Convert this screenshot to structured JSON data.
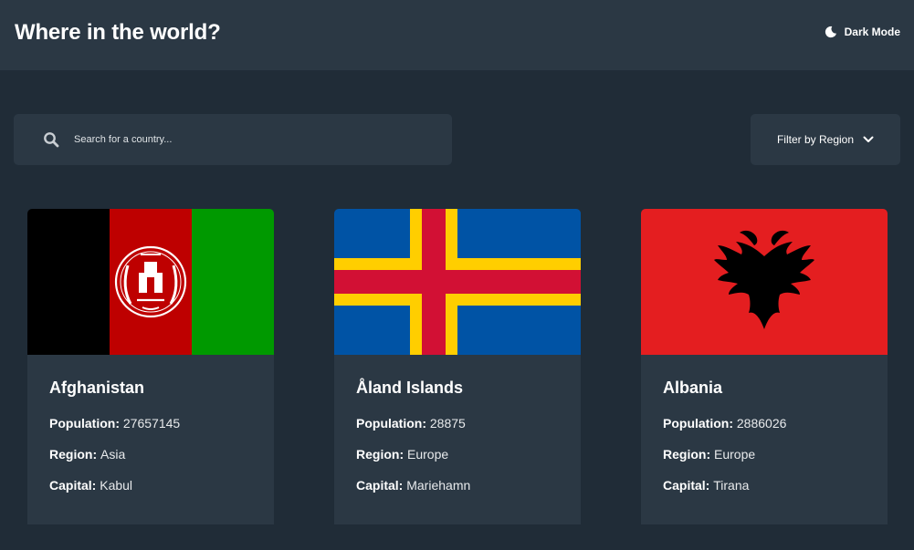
{
  "header": {
    "title": "Where in the world?",
    "mode_label": "Dark Mode"
  },
  "search": {
    "placeholder": "Search for a country..."
  },
  "filter": {
    "label": "Filter by Region"
  },
  "labels": {
    "population": "Population:",
    "region": "Region:",
    "capital": "Capital:"
  },
  "countries": [
    {
      "name": "Afghanistan",
      "population": "27657145",
      "region": "Asia",
      "capital": "Kabul"
    },
    {
      "name": "Åland Islands",
      "population": "28875",
      "region": "Europe",
      "capital": "Mariehamn"
    },
    {
      "name": "Albania",
      "population": "2886026",
      "region": "Europe",
      "capital": "Tirana"
    }
  ],
  "colors": {
    "background": "#202c37",
    "element": "#2b3844",
    "text": "#ffffff"
  }
}
